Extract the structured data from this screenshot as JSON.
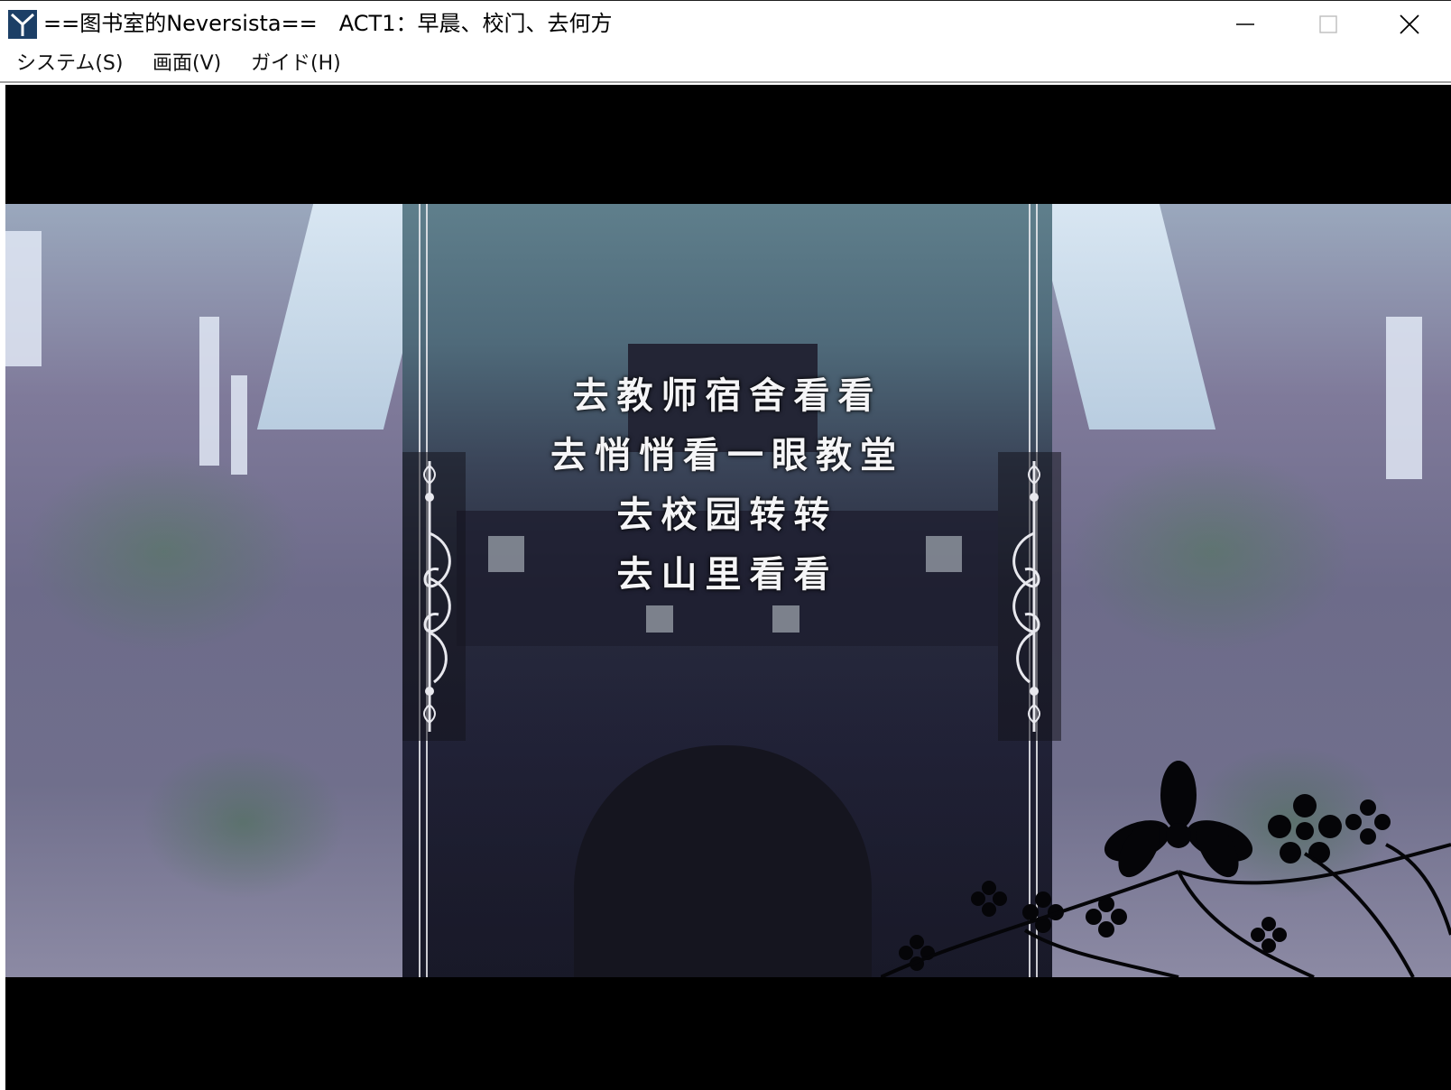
{
  "window": {
    "title": "==图书室的Neversista==　ACT1：早晨、校门、去何方",
    "icon": "app-icon",
    "controls": [
      "minimize-icon",
      "maximize-icon",
      "close-icon"
    ]
  },
  "menu": {
    "items": [
      {
        "label": "システム(S)"
      },
      {
        "label": "画面(V)"
      },
      {
        "label": "ガイド(H)"
      }
    ]
  },
  "game": {
    "choices": [
      {
        "label": "去教师宿舍看看"
      },
      {
        "label": "去悄悄看一眼教堂"
      },
      {
        "label": "去校园转转"
      },
      {
        "label": "去山里看看"
      }
    ],
    "colors": {
      "letterbox": "#000000",
      "choice_text": "#f5f5f7",
      "side_tint": "#7f7a9a",
      "center_tint": "#272a3c"
    }
  }
}
